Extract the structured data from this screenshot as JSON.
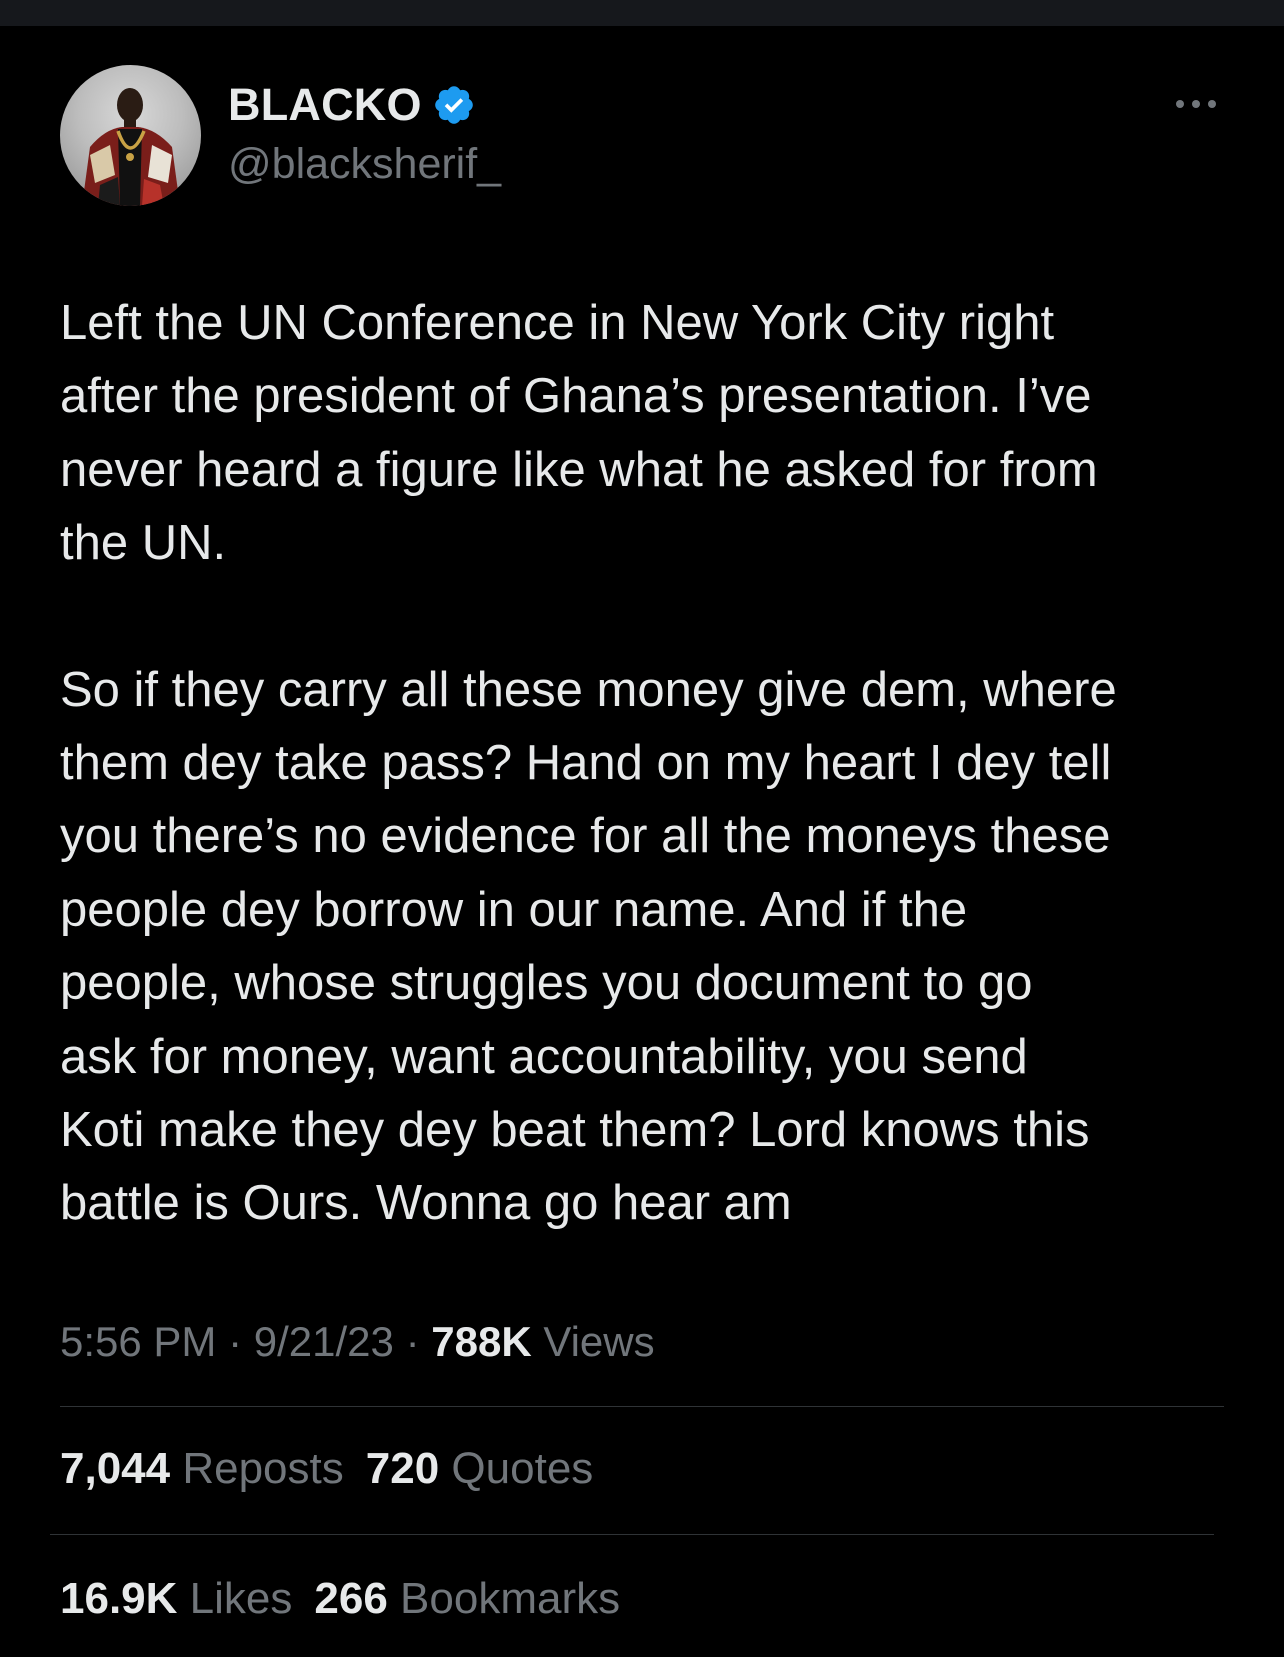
{
  "author": {
    "display_name": "BLACKO",
    "handle": "@blacksherif_",
    "verified_icon": "verified-badge-icon",
    "verified_color": "#1d9bf0"
  },
  "more_icon": "more-options-icon",
  "tweet": {
    "lines": [
      "Left the UN Conference in New York City right",
      "after the president of Ghana’s presentation. I’ve",
      "never heard a figure like what he asked for from",
      "the UN.",
      "",
      "So if they carry all these money give dem, where",
      "them dey take pass? Hand on my heart I dey tell",
      "you there’s no evidence for all the moneys these",
      "people dey borrow in our name. And if the",
      "people, whose struggles you document to go",
      "ask for money, want accountability, you send",
      "Koti make they dey beat them? Lord knows this",
      "battle is Ours. Wonna go hear am"
    ]
  },
  "meta": {
    "time": "5:56 PM",
    "separator": "·",
    "date": "9/21/23",
    "views_count": "788K",
    "views_label": "Views"
  },
  "stats": {
    "reposts_count": "7,044",
    "reposts_label": "Reposts",
    "quotes_count": "720",
    "quotes_label": "Quotes",
    "likes_count": "16.9K",
    "likes_label": "Likes",
    "bookmarks_count": "266",
    "bookmarks_label": "Bookmarks"
  },
  "colors": {
    "background": "#000000",
    "text_primary": "#e7e9ea",
    "text_secondary": "#71767b",
    "divider": "#2f3336"
  }
}
